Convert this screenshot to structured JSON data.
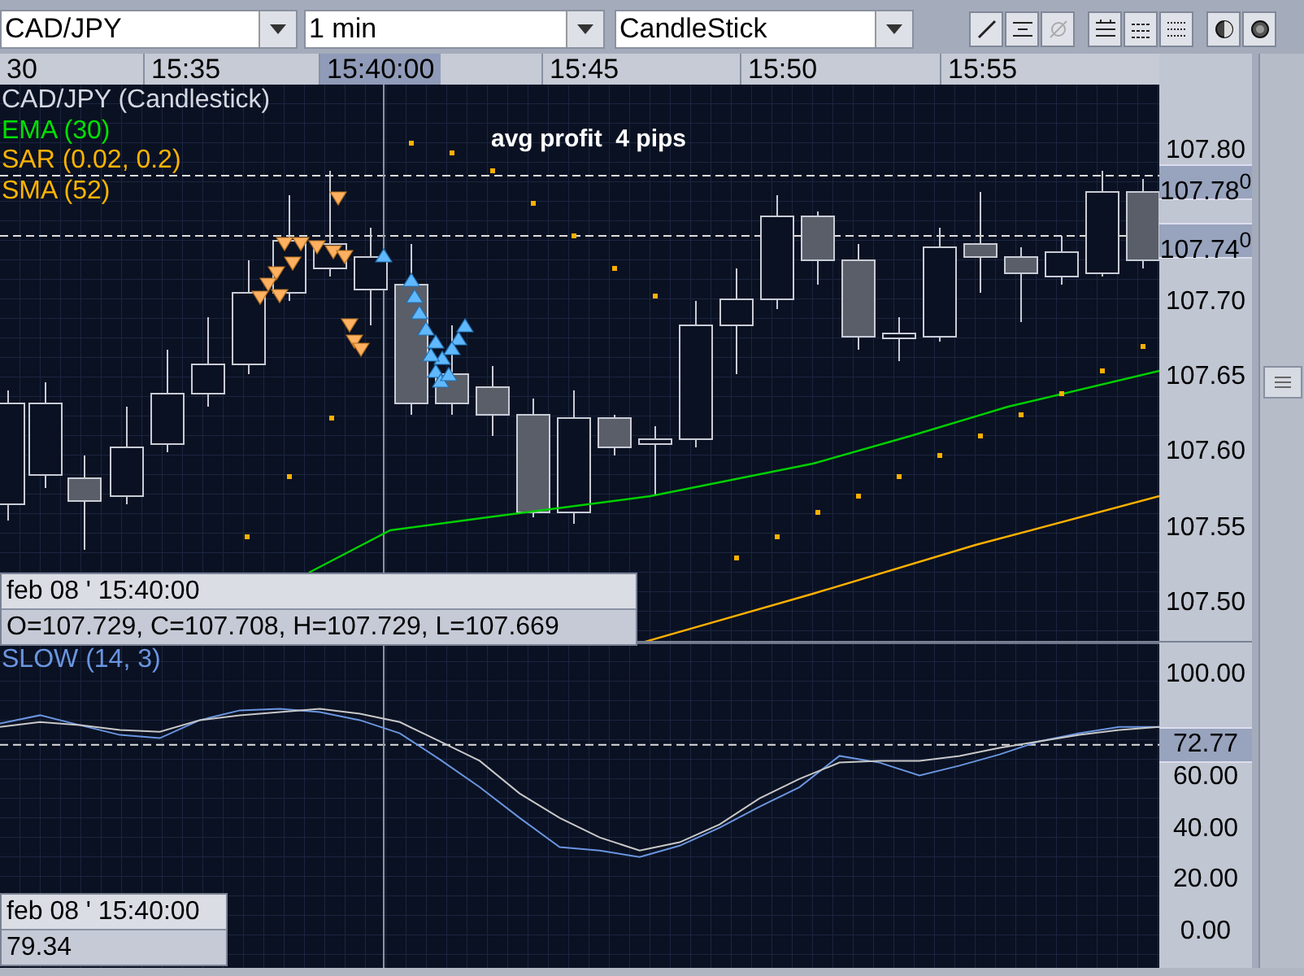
{
  "toolbar": {
    "symbol": "CAD/JPY",
    "interval": "1 min",
    "chart_type": "CandleStick"
  },
  "time_axis": [
    {
      "text": "30",
      "selected": false
    },
    {
      "text": "15:35",
      "selected": false
    },
    {
      "text": "15:40:00",
      "selected": true
    },
    {
      "text": "15:45",
      "selected": false
    },
    {
      "text": "15:50",
      "selected": false
    },
    {
      "text": "15:55",
      "selected": false
    }
  ],
  "legend": [
    {
      "text": "CAD/JPY (Candlestick)",
      "color": "#d4d8e2"
    },
    {
      "text": "EMA (30)",
      "color": "#00e000"
    },
    {
      "text": "SAR (0.02, 0.2)",
      "color": "#ffb400"
    },
    {
      "text": "SMA (52)",
      "color": "#ffb400"
    }
  ],
  "annotation": "avg profit  4 pips",
  "price_axis": [
    "107.80",
    "107.70",
    "107.65",
    "107.60",
    "107.55",
    "107.50"
  ],
  "price_markers": [
    "107.78$^{0}$",
    "107.74$^{0}$"
  ],
  "info_box": {
    "date": "feb 08 ' 15:40:00",
    "values": "O=107.729, C=107.708, H=107.729, L=107.669"
  },
  "oscillator": {
    "title": "SLOW (14, 3)",
    "info_box": {
      "date": "feb 08 ' 15:40:00",
      "value": "79.34"
    },
    "chart_data": {
      "type": "line",
      "ylim": [
        -14,
        112.5
      ],
      "ref_lines": [
        {
          "axis": "y",
          "value": 72.77,
          "label": "72.77"
        }
      ],
      "yticks": [
        {
          "value": 100,
          "label": "100.00"
        },
        {
          "value": 60,
          "label": "60.00"
        },
        {
          "value": 40,
          "label": "40.00"
        },
        {
          "value": 20,
          "label": "20.00"
        },
        {
          "value": 0,
          "label": "0.00"
        }
      ],
      "series": [
        {
          "color": "#6a95e0",
          "values": [
            81.0,
            84.2,
            80.4,
            76.6,
            75.3,
            82.3,
            86.1,
            86.7,
            85.4,
            82.3,
            77.2,
            67.1,
            56.3,
            44.3,
            32.9,
            31.6,
            29.1,
            33.5,
            40.5,
            48.7,
            56.3,
            68.4,
            65.8,
            60.8,
            64.6,
            69.0,
            74.1,
            77.2,
            79.7,
            79.7
          ]
        },
        {
          "color": "#c8c8c8",
          "values": [
            79.7,
            81.6,
            80.4,
            78.5,
            77.8,
            82.3,
            84.2,
            85.4,
            86.7,
            84.8,
            81.6,
            74.1,
            66.5,
            53.8,
            44.3,
            36.7,
            31.6,
            34.8,
            41.8,
            51.9,
            59.5,
            65.8,
            66.5,
            66.5,
            68.4,
            71.5,
            74.1,
            76.6,
            78.5,
            79.7
          ]
        }
      ]
    }
  }
}
